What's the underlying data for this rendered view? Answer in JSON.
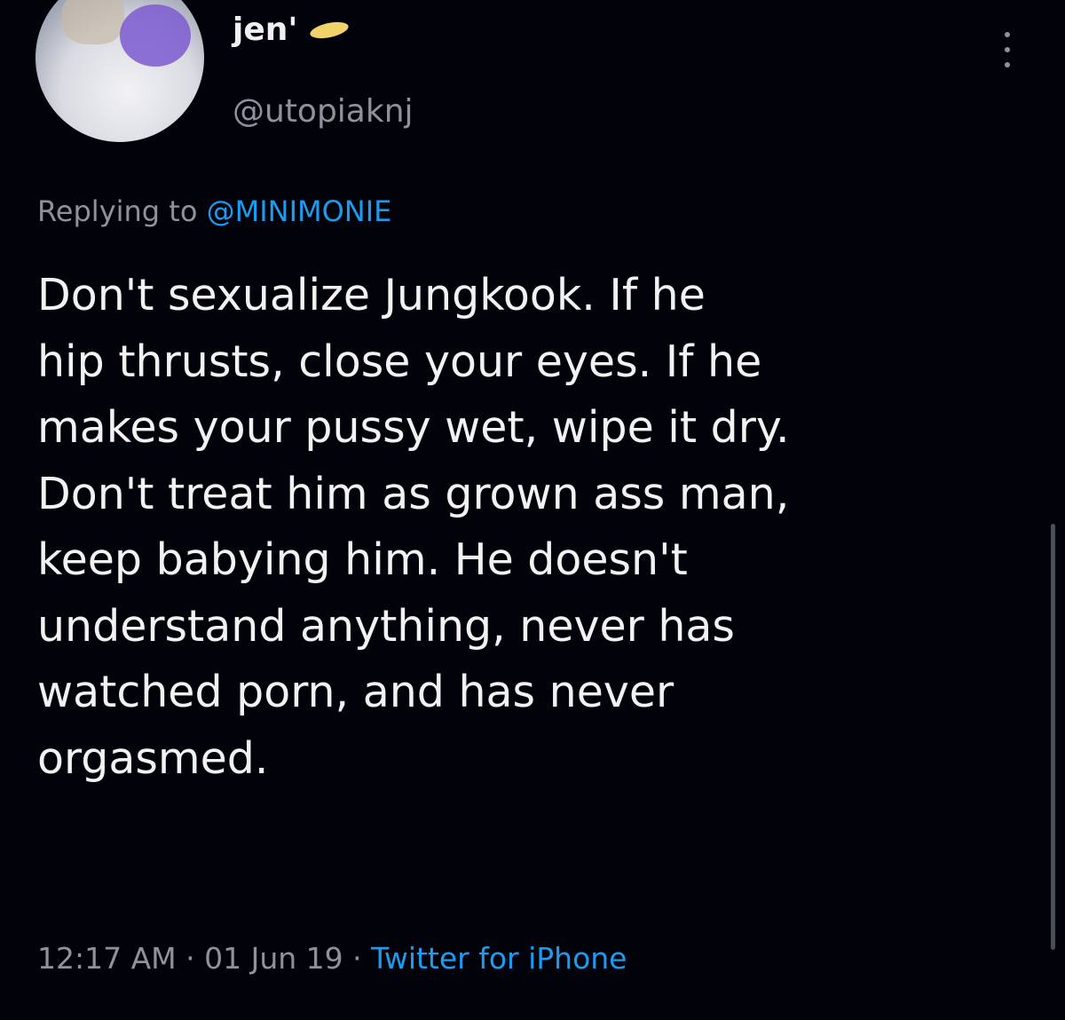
{
  "author": {
    "display_name": "jen'",
    "handle": "@utopiaknj",
    "avatar_icon": "avatar",
    "emoji_icon": "emoji-icon"
  },
  "reply": {
    "prefix": "Replying to ",
    "mention": "@MINIMONIE"
  },
  "tweet": {
    "text": "Don't sexualize Jungkook. If he\nhip thrusts, close your eyes. If he\nmakes your pussy wet, wipe it dry.\nDon't treat him as grown ass man,\nkeep babying him. He doesn't\nunderstand anything, never has\nwatched porn, and has never\norgasmed."
  },
  "meta": {
    "time": "12:17 AM",
    "separator1": " · ",
    "date": "01 Jun 19",
    "separator2": " · ",
    "source": "Twitter for iPhone"
  },
  "colors": {
    "background": "#02030a",
    "text": "#f2f2f2",
    "muted": "#8e939b",
    "link": "#1d9bf0"
  },
  "icons": {
    "more": "more-options-icon"
  }
}
